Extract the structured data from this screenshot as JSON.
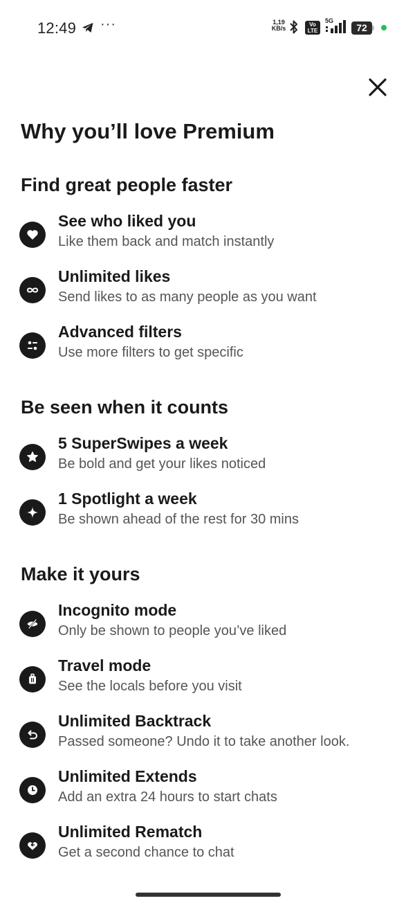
{
  "status_bar": {
    "time": "12:49",
    "net_speed_value": "1,19",
    "net_speed_unit": "KB/s",
    "volte": "Vo LTE",
    "network": "5G",
    "battery": "72"
  },
  "page": {
    "title": "Why you’ll love Premium"
  },
  "sections": [
    {
      "title": "Find great people faster",
      "features": [
        {
          "icon": "heart-icon",
          "title": "See who liked you",
          "desc": "Like them back and match instantly"
        },
        {
          "icon": "infinity-icon",
          "title": "Unlimited likes",
          "desc": "Send likes to as many people as you want"
        },
        {
          "icon": "filters-icon",
          "title": "Advanced filters",
          "desc": "Use more filters to get specific"
        }
      ]
    },
    {
      "title": "Be seen when it counts",
      "features": [
        {
          "icon": "star-icon",
          "title": "5 SuperSwipes a week",
          "desc": "Be bold and get your likes noticed"
        },
        {
          "icon": "spotlight-icon",
          "title": "1 Spotlight a week",
          "desc": "Be shown ahead of the rest for 30 mins"
        }
      ]
    },
    {
      "title": "Make it yours",
      "features": [
        {
          "icon": "incognito-icon",
          "title": "Incognito mode",
          "desc": "Only be shown to people you’ve liked"
        },
        {
          "icon": "suitcase-icon",
          "title": "Travel mode",
          "desc": "See the locals before you visit"
        },
        {
          "icon": "backtrack-icon",
          "title": "Unlimited Backtrack",
          "desc": "Passed someone? Undo it to take another look."
        },
        {
          "icon": "clock-icon",
          "title": "Unlimited Extends",
          "desc": "Add an extra 24 hours to start chats"
        },
        {
          "icon": "rematch-icon",
          "title": "Unlimited Rematch",
          "desc": "Get a second chance to chat"
        }
      ]
    }
  ]
}
